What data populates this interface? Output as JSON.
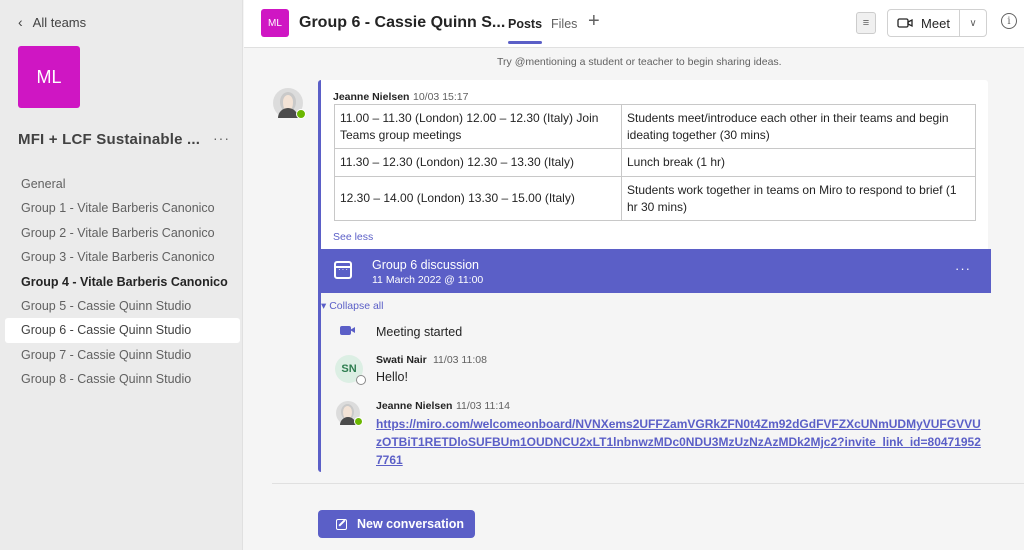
{
  "sidebar": {
    "back_label": "All teams",
    "team_initials": "ML",
    "team_name": "MFI + LCF Sustainable ...",
    "more": "···",
    "channels": [
      {
        "label": "General"
      },
      {
        "label": "Group 1 - Vitale Barberis Canonico"
      },
      {
        "label": "Group 2 - Vitale Barberis Canonico"
      },
      {
        "label": "Group 3 - Vitale Barberis Canonico"
      },
      {
        "label": "Group 4 - Vitale Barberis Canonico",
        "bold": true
      },
      {
        "label": "Group 5 - Cassie Quinn Studio"
      },
      {
        "label": "Group 6 - Cassie Quinn Studio",
        "active": true
      },
      {
        "label": "Group 7 - Cassie Quinn Studio"
      },
      {
        "label": "Group 8 - Cassie Quinn Studio"
      }
    ]
  },
  "header": {
    "initials": "ML",
    "title": "Group 6 - Cassie Quinn S...",
    "tabs": {
      "posts": "Posts",
      "files": "Files",
      "add": "+"
    },
    "meet_label": "Meet",
    "info": "i"
  },
  "hint": "Try @mentioning a student or teacher to begin sharing ideas.",
  "post": {
    "author": "Jeanne Nielsen",
    "time": "10/03 15:17",
    "table": [
      [
        "11.00 – 11.30 (London) 12.00 – 12.30 (Italy)  Join Teams group meetings",
        "Students meet/introduce each other in their teams and begin ideating together (30 mins)"
      ],
      [
        "11.30 – 12.30 (London) 12.30 – 13.30 (Italy)",
        "Lunch break (1 hr)"
      ],
      [
        "12.30 – 14.00 (London) 13.30 – 15.00 (Italy)",
        "Students work together in teams on Miro to respond to brief (1 hr 30 mins)"
      ]
    ],
    "see_less": "See less",
    "meeting": {
      "title": "Group 6 discussion",
      "date": "11 March 2022 @ 11:00",
      "more": "···"
    },
    "collapse_all": "▾ Collapse all",
    "meeting_started": "Meeting started",
    "replies": [
      {
        "initials": "SN",
        "author": "Swati Nair",
        "time": "11/03 11:08",
        "text": "Hello!"
      },
      {
        "author": "Jeanne Nielsen",
        "time": "11/03 11:14",
        "link": "https://miro.com/welcomeonboard/NVNXems2UFFZamVGRkZFN0t4Zm92dGdFVFZXcUNmUDMyVUFGVVUzOTBiT1RETDloSUFBUm1OUDNCU2xLT1lnbnwzMDc0NDU3MzUzNzAzMDk2Mjc2?invite_link_id=804719527761"
      }
    ]
  },
  "new_conversation": "New conversation",
  "colors": {
    "accent": "#5b5fc7",
    "team": "#cf16c3"
  }
}
